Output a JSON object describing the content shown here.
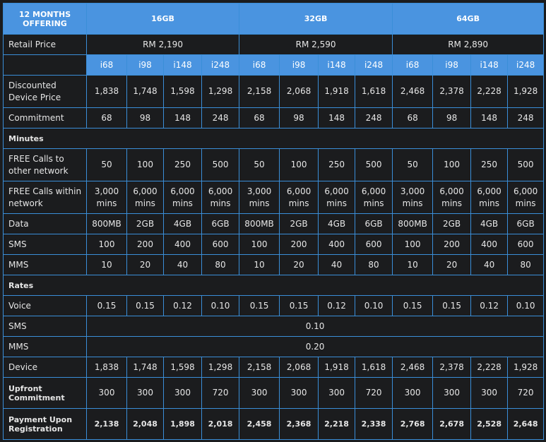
{
  "header": {
    "offering": "12 MONTHS OFFERING",
    "storage": [
      "16GB",
      "32GB",
      "64GB"
    ]
  },
  "retail": {
    "label": "Retail Price",
    "values": [
      "RM 2,190",
      "RM 2,590",
      "RM 2,890"
    ]
  },
  "plans": [
    "i68",
    "i98",
    "i148",
    "i248",
    "i68",
    "i98",
    "i148",
    "i248",
    "i68",
    "i98",
    "i148",
    "i248"
  ],
  "rows_top": [
    {
      "label": "Discounted Device Price",
      "values": [
        "1,838",
        "1,748",
        "1,598",
        "1,298",
        "2,158",
        "2,068",
        "1,918",
        "1,618",
        "2,468",
        "2,378",
        "2,228",
        "1,928"
      ]
    },
    {
      "label": "Commitment",
      "values": [
        "68",
        "98",
        "148",
        "248",
        "68",
        "98",
        "148",
        "248",
        "68",
        "98",
        "148",
        "248"
      ]
    }
  ],
  "minutes_section": "Minutes",
  "rows_minutes": [
    {
      "label": "FREE Calls to other network",
      "values": [
        "50",
        "100",
        "250",
        "500",
        "50",
        "100",
        "250",
        "500",
        "50",
        "100",
        "250",
        "500"
      ]
    },
    {
      "label": "FREE Calls within network",
      "values": [
        "3,000 mins",
        "6,000 mins",
        "6,000 mins",
        "6,000 mins",
        "3,000 mins",
        "6,000 mins",
        "6,000 mins",
        "6,000 mins",
        "3,000 mins",
        "6,000 mins",
        "6,000 mins",
        "6,000 mins"
      ]
    },
    {
      "label": "Data",
      "values": [
        "800MB",
        "2GB",
        "4GB",
        "6GB",
        "800MB",
        "2GB",
        "4GB",
        "6GB",
        "800MB",
        "2GB",
        "4GB",
        "6GB"
      ]
    },
    {
      "label": "SMS",
      "values": [
        "100",
        "200",
        "400",
        "600",
        "100",
        "200",
        "400",
        "600",
        "100",
        "200",
        "400",
        "600"
      ]
    },
    {
      "label": "MMS",
      "values": [
        "10",
        "20",
        "40",
        "80",
        "10",
        "20",
        "40",
        "80",
        "10",
        "20",
        "40",
        "80"
      ]
    }
  ],
  "rates_section": "Rates",
  "rates_voice": {
    "label": "Voice",
    "values": [
      "0.15",
      "0.15",
      "0.12",
      "0.10",
      "0.15",
      "0.15",
      "0.12",
      "0.10",
      "0.15",
      "0.15",
      "0.12",
      "0.10"
    ]
  },
  "rates_sms": {
    "label": "SMS",
    "value": "0.10"
  },
  "rates_mms": {
    "label": "MMS",
    "value": "0.20"
  },
  "device": {
    "label": "Device",
    "values": [
      "1,838",
      "1,748",
      "1,598",
      "1,298",
      "2,158",
      "2,068",
      "1,918",
      "1,618",
      "2,468",
      "2,378",
      "2,228",
      "1,928"
    ]
  },
  "upfront": {
    "label": "Upfront Commitment",
    "values": [
      "300",
      "300",
      "300",
      "720",
      "300",
      "300",
      "300",
      "720",
      "300",
      "300",
      "300",
      "720"
    ]
  },
  "payment": {
    "label": "Payment Upon Registration",
    "values": [
      "2,138",
      "2,048",
      "1,898",
      "2,018",
      "2,458",
      "2,368",
      "2,218",
      "2,338",
      "2,768",
      "2,678",
      "2,528",
      "2,648"
    ]
  }
}
